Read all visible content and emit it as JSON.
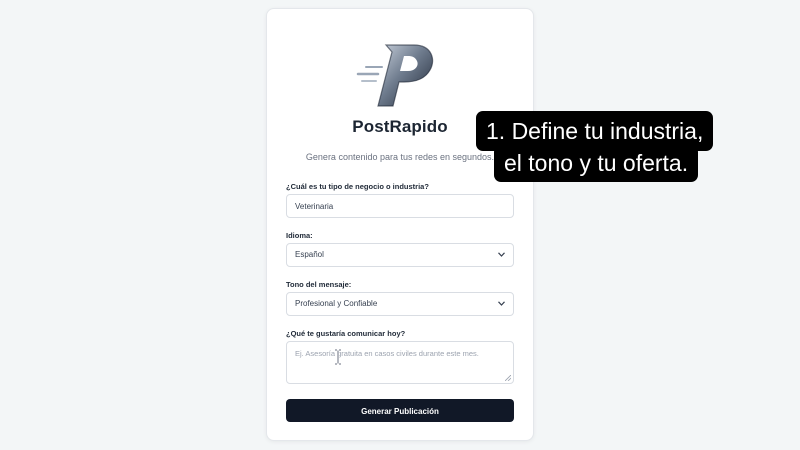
{
  "brand": {
    "name": "PostRapido",
    "tagline": "Genera contenido para tus redes en segundos."
  },
  "form": {
    "business": {
      "label": "¿Cuál es tu tipo de negocio o industria?",
      "value": "Veterinaria"
    },
    "language": {
      "label": "Idioma:",
      "selected": "Español"
    },
    "tone": {
      "label": "Tono del mensaje:",
      "selected": "Profesional y Confiable"
    },
    "message": {
      "label": "¿Qué te gustaría comunicar hoy?",
      "placeholder": "Ej. Asesoría gratuita en casos civiles durante este mes."
    },
    "submit_label": "Generar Publicación"
  },
  "caption": {
    "line1": "1. Define tu industria,",
    "line2": "el tono y tu oferta."
  },
  "colors": {
    "button_bg": "#111827",
    "logo_dark": "#1c2433",
    "logo_light": "#9aa6b6",
    "caption_bg": "#000000"
  },
  "icons": {
    "logo": "postrapido-p-logo",
    "select_arrow": "chevron-down-icon",
    "cursor": "text-cursor-icon",
    "resize": "resize-grip-icon"
  }
}
